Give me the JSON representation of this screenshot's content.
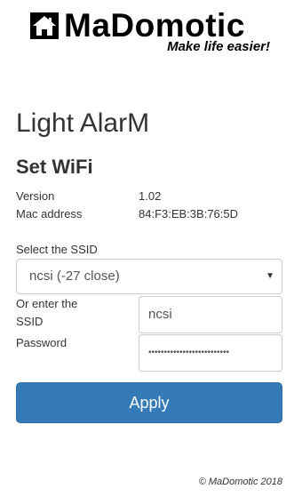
{
  "logo": {
    "icon": "house-icon",
    "name": "MaDomotic",
    "tagline": "Make life easier!"
  },
  "page": {
    "title": "Light AlarM",
    "subtitle": "Set WiFi"
  },
  "info": {
    "version_label": "Version",
    "version_value": "1.02",
    "mac_label": "Mac address",
    "mac_value": "84:F3:EB:3B:76:5D"
  },
  "form": {
    "ssid_select_label": "Select the SSID",
    "ssid_selected": "ncsi (-27 close)",
    "ssid_manual_label_line1": "Or enter the",
    "ssid_manual_label_line2": "SSID",
    "ssid_manual_value": "ncsi",
    "password_label": "Password",
    "password_value": "••••••••••••••••••••••••••",
    "apply_label": "Apply"
  },
  "footer": {
    "copyright": "© MaDomotic 2018"
  },
  "colors": {
    "primary_button": "#337ab7",
    "text": "#333333"
  }
}
